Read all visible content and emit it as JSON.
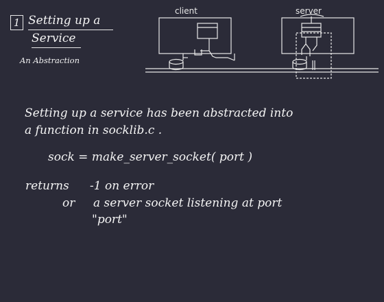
{
  "header": {
    "slide_number": "1",
    "title_line1": "Setting up a",
    "title_line2": "Service",
    "subtitle": "An Abstraction"
  },
  "diagram": {
    "client_label": "client",
    "server_label": "server"
  },
  "body": {
    "paragraph_line1": "Setting up a service has been abstracted into",
    "paragraph_line2": "a function in  socklib.c .",
    "code_line": "sock =  make_server_socket( port )",
    "returns_label": "returns",
    "returns_value1": "-1  on error",
    "or_label": "or",
    "returns_value2": "a server socket listening at  port",
    "returns_value3": "\"port\""
  },
  "colors": {
    "background": "#2b2b38",
    "foreground": "#f2f2f2"
  }
}
